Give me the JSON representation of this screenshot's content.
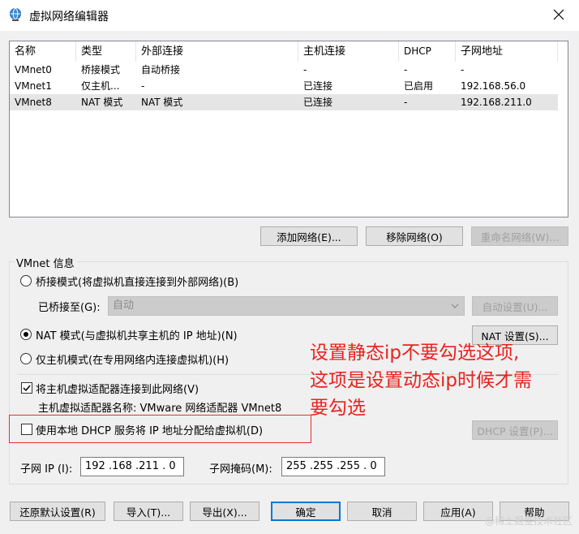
{
  "window": {
    "title": "虚拟网络编辑器",
    "close_icon": "close-icon",
    "app_icon": "network-globe-icon"
  },
  "table": {
    "columns": [
      "名称",
      "类型",
      "外部连接",
      "主机连接",
      "DHCP",
      "子网地址"
    ],
    "rows": [
      [
        "VMnet0",
        "桥接模式",
        "自动桥接",
        "-",
        "-",
        "-"
      ],
      [
        "VMnet1",
        "仅主机...",
        "-",
        "已连接",
        "已启用",
        "192.168.56.0"
      ],
      [
        "VMnet8",
        "NAT 模式",
        "NAT 模式",
        "已连接",
        "-",
        "192.168.211.0"
      ]
    ],
    "selected_row": 2
  },
  "table_buttons": {
    "add": "添加网络(E)...",
    "remove": "移除网络(O)",
    "rename": "重命名网络(W)..."
  },
  "vmnet_info": {
    "legend": "VMnet 信息",
    "bridged_label": "桥接模式(将虚拟机直接连接到外部网络)(B)",
    "bridged_to_label": "已桥接至(G):",
    "bridged_to_value": "自动",
    "auto_settings": "自动设置(U)...",
    "nat_label": "NAT 模式(与虚拟机共享主机的 IP 地址)(N)",
    "nat_settings": "NAT 设置(S)...",
    "hostonly_label": "仅主机模式(在专用网络内连接虚拟机)(H)",
    "connect_adapter_label": "将主机虚拟适配器连接到此网络(V)",
    "adapter_name_label": "主机虚拟适配器名称: VMware 网络适配器 VMnet8",
    "dhcp_label": "使用本地 DHCP 服务将 IP 地址分配给虚拟机(D)",
    "dhcp_settings": "DHCP 设置(P)...",
    "subnet_ip_label": "子网 IP (I):",
    "subnet_ip_value": "192 .168 .211 .  0",
    "subnet_mask_label": "子网掩码(M):",
    "subnet_mask_value": "255 .255 .255 .  0",
    "selected_mode": "nat",
    "connect_adapter_checked": true,
    "dhcp_checked": false
  },
  "annotation": {
    "lines": [
      "设置静态ip不要勾选这项,",
      "这项是设置动态ip时候才需",
      "要勾选"
    ],
    "color": "#e8231f"
  },
  "footer_buttons": {
    "restore": "还原默认设置(R)",
    "import": "导入(T)...",
    "export": "导出(X)...",
    "ok": "确定",
    "cancel": "取消",
    "apply": "应用(A)",
    "help": "帮助"
  },
  "watermark": "@稀土掘金技术社区",
  "colors": {
    "accent": "#0078d7",
    "selected_row": "#e5e5e5",
    "annotation_red": "#e8231f"
  }
}
